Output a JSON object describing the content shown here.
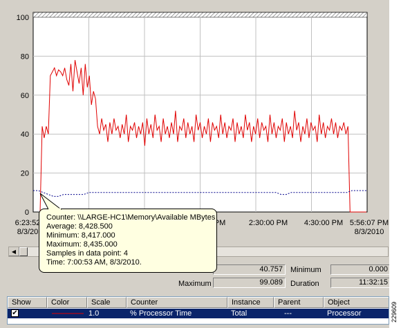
{
  "chart_data": {
    "type": "line",
    "title": "",
    "ylim": [
      0,
      100
    ],
    "y_ticks": [
      "0",
      "20",
      "40",
      "60",
      "80",
      "100"
    ],
    "x_tick_labels": [
      {
        "time": "6:23:52",
        "date": "8/3/20"
      },
      {
        "time": "PM",
        "date": ""
      },
      {
        "time": "2:30:00 PM",
        "date": ""
      },
      {
        "time": "4:30:00 PM",
        "date": ""
      },
      {
        "time": "5:56:07 PM",
        "date": "8/3/2010"
      }
    ],
    "grid": true,
    "series": [
      {
        "name": "% Processor Time",
        "color": "#e00000",
        "style": "solid",
        "values": [
          0,
          44,
          38,
          44,
          40,
          70,
          72,
          74,
          70,
          73,
          72,
          70,
          74,
          68,
          65,
          76,
          62,
          78,
          72,
          66,
          74,
          60,
          76,
          64,
          70,
          55,
          62,
          58,
          44,
          40,
          48,
          42,
          45,
          36,
          46,
          40,
          48,
          42,
          44,
          38,
          45,
          40,
          50,
          36,
          44,
          42,
          46,
          38,
          44,
          40,
          46,
          34,
          48,
          40,
          45,
          38,
          50,
          42,
          44,
          36,
          48,
          40,
          44,
          38,
          46,
          40,
          52,
          36,
          44,
          42,
          48,
          38,
          46,
          40,
          44,
          36,
          50,
          42,
          46,
          38,
          44,
          40,
          48,
          36,
          46,
          42,
          44,
          38,
          50,
          40,
          46,
          38,
          44,
          42,
          48,
          36,
          46,
          40,
          44,
          38,
          50,
          42,
          46,
          36,
          44,
          40,
          48,
          38,
          46,
          42,
          44,
          36,
          50,
          40,
          46,
          38,
          44,
          42,
          48,
          36,
          46,
          40,
          44,
          38,
          52,
          42,
          46,
          36,
          44,
          40,
          48,
          38,
          46,
          42,
          44,
          36,
          50,
          40,
          46,
          38,
          44,
          42,
          48,
          40,
          46,
          38,
          44,
          42,
          46,
          40,
          44,
          0,
          0,
          0,
          0,
          0,
          0,
          0,
          0,
          0
        ]
      },
      {
        "name": "Available MBytes",
        "color": "#00008b",
        "style": "dashed",
        "values": [
          11,
          11,
          10,
          9,
          8,
          8,
          9,
          9,
          9,
          9,
          9,
          10,
          10,
          10,
          10,
          10,
          10,
          10,
          10,
          10,
          10,
          10,
          10,
          10,
          10,
          10,
          10,
          10,
          10,
          10,
          10,
          10,
          10,
          10,
          10,
          10,
          10,
          10,
          10,
          10,
          10,
          10,
          10,
          10,
          10,
          10,
          10,
          10,
          10,
          9,
          9,
          10,
          10,
          10,
          10,
          10,
          10,
          10,
          10,
          10,
          10,
          10,
          10,
          11,
          11,
          11,
          11
        ]
      }
    ]
  },
  "tooltip": {
    "counter": "Counter: \\\\LARGE-HC1\\Memory\\Available MBytes",
    "average": "Average: 8,428.500",
    "minimum": "Minimum: 8,417.000",
    "maximum": "Maximum: 8,435.000",
    "samples": "Samples in data point:  4",
    "time": "Time:    7:00:53 AM, 8/3/2010."
  },
  "stats": {
    "last_value": "40.757",
    "minimum_label": "Minimum",
    "minimum_value": "0.000",
    "maximum_label": "Maximum",
    "maximum_value": "99.089",
    "duration_label": "Duration",
    "duration_value": "11:32:15"
  },
  "legend": {
    "headers": [
      "Show",
      "Color",
      "Scale",
      "Counter",
      "Instance",
      "Parent",
      "Object"
    ],
    "row": {
      "scale": "1.0",
      "counter": "% Processor Time",
      "instance": "Total",
      "parent": "---",
      "object": "Processor",
      "color": "#e00000"
    }
  },
  "figure_id": "229609"
}
